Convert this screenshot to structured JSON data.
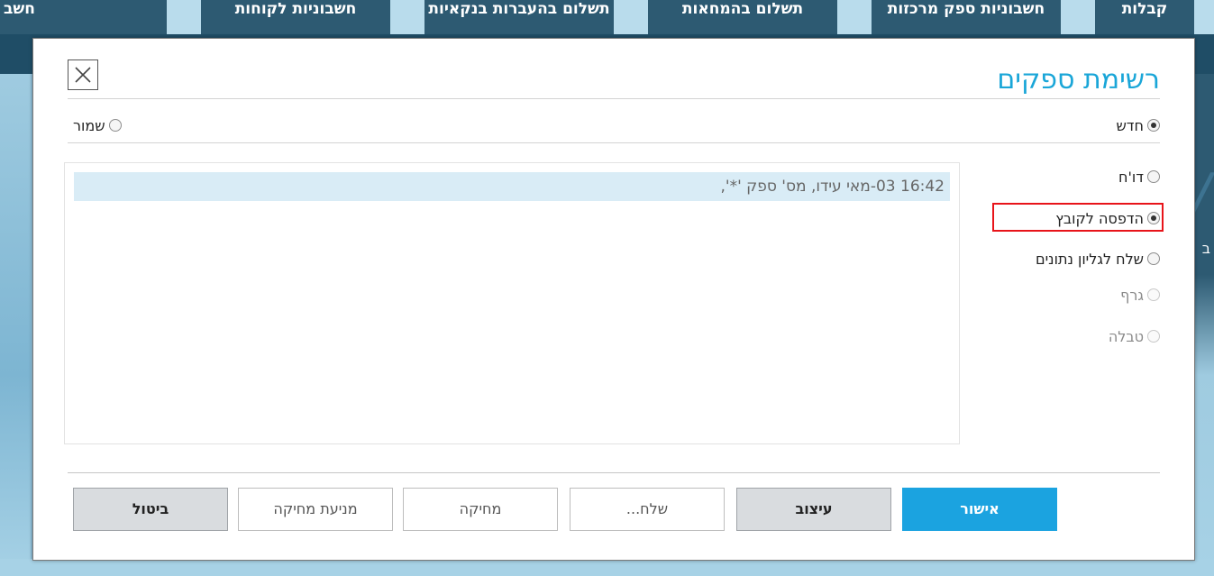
{
  "background": {
    "tabs": [
      "קבלות",
      "חשבוניות ספק מרכזות",
      "תשלום בהמחאות",
      "תשלום בהעברות בנקאיות",
      "חשבוניות לקוחות",
      "חשבו"
    ],
    "left_fragment": "חשב",
    "right_fragment": "ב"
  },
  "dialog": {
    "title": "רשימת ספקים",
    "close_label": "✕",
    "modes": {
      "new": {
        "label": "חדש",
        "checked": true
      },
      "saved": {
        "label": "שמור",
        "checked": false
      }
    },
    "output_options": [
      {
        "label": "דו'ח",
        "checked": false,
        "disabled": false
      },
      {
        "label": "הדפסה לקובץ",
        "checked": true,
        "disabled": false
      },
      {
        "label": "שלח לגליון נתונים",
        "checked": false,
        "disabled": false
      },
      {
        "label": "גרף",
        "checked": false,
        "disabled": true
      },
      {
        "label": "טבלה",
        "checked": false,
        "disabled": true
      }
    ],
    "reports": [
      "16:42 03-מאי עידו, מס' ספק '*',"
    ],
    "buttons": {
      "ok": "אישור",
      "design": "עיצוב",
      "send": "שלח...",
      "delete": "מחיקה",
      "protect": "מניעת מחיקה",
      "cancel": "ביטול"
    }
  },
  "colors": {
    "title": "#1aa6d8",
    "primary_button": "#1ba3e0",
    "highlight": "#e8141a",
    "selected_row": "#d9ecf6",
    "nav": "#1f4d66"
  }
}
